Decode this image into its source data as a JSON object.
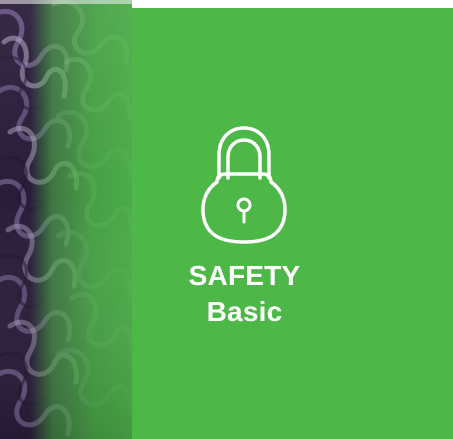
{
  "card": {
    "title": "SAFETY",
    "subtitle": "Basic",
    "icon": "lock-icon"
  },
  "colors": {
    "panel_green": "#4db848",
    "text_white": "#ffffff",
    "photo_dark_purple": "#2a1d3a",
    "photo_green_tint": "#4db848"
  }
}
